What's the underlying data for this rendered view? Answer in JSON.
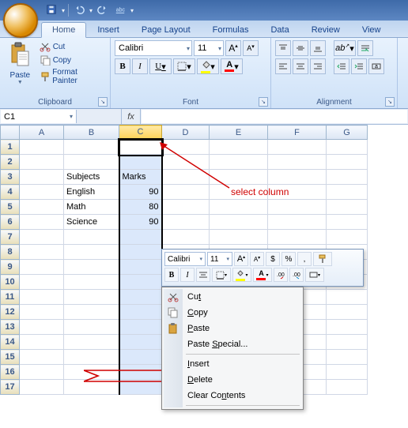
{
  "tabs": [
    "Home",
    "Insert",
    "Page Layout",
    "Formulas",
    "Data",
    "Review",
    "View"
  ],
  "active_tab": 0,
  "clipboard": {
    "paste": "Paste",
    "cut": "Cut",
    "copy": "Copy",
    "format_painter": "Format Painter",
    "group": "Clipboard"
  },
  "font": {
    "name": "Calibri",
    "size": "11",
    "group": "Font"
  },
  "alignment": {
    "group": "Alignment"
  },
  "namebox": "C1",
  "cells": {
    "b3": "Subjects",
    "c3": "Marks",
    "b4": "English",
    "c4": "90",
    "b5": "Math",
    "c5": "80",
    "b6": "Science",
    "c6": "90"
  },
  "columns": [
    "A",
    "B",
    "C",
    "D",
    "E",
    "F",
    "G"
  ],
  "rows": [
    "1",
    "2",
    "3",
    "4",
    "5",
    "6",
    "7",
    "8",
    "9",
    "10",
    "11",
    "12",
    "13",
    "14",
    "15",
    "16",
    "17"
  ],
  "mini": {
    "font": "Calibri",
    "size": "11",
    "currency": "$",
    "percent": "%"
  },
  "context": {
    "cut": "Cut",
    "copy": "Copy",
    "paste": "Paste",
    "paste_special": "Paste Special...",
    "insert": "Insert",
    "delete": "Delete",
    "clear": "Clear Contents"
  },
  "annotations": {
    "select_col": "select column"
  }
}
